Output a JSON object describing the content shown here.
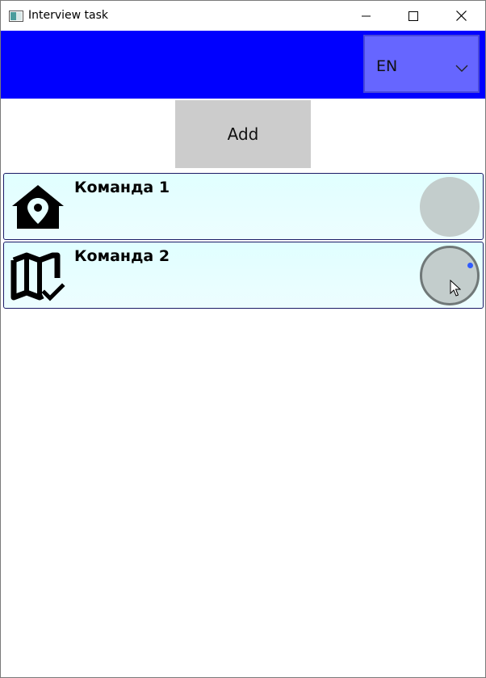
{
  "window": {
    "title": "Interview task"
  },
  "header": {
    "background_color": "#0000ff",
    "language_select": {
      "value": "EN",
      "background_color": "#6666ff"
    }
  },
  "actions": {
    "add_label": "Add"
  },
  "teams": [
    {
      "name": "Команда 1",
      "icon": "home-location-icon"
    },
    {
      "name": "Команда 2",
      "icon": "map-check-icon"
    }
  ],
  "colors": {
    "item_background": "#e0ffff",
    "item_border": "#1a1a66",
    "toggle_fill": "#c3cdcc",
    "button_gray": "#cccccc"
  }
}
